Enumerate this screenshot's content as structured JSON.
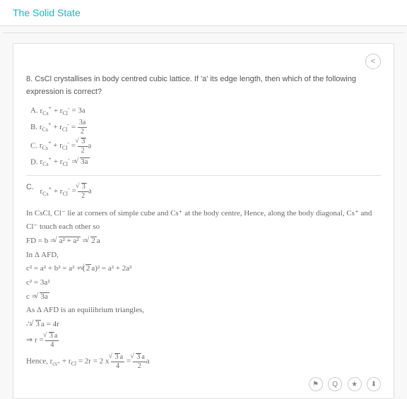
{
  "header": {
    "title": "The Solid State"
  },
  "question": {
    "text": "8.  CsCl crystallises in body centred cubic lattice. If 'a' its edge length, then which of the following expression is correct?"
  },
  "options": {
    "A": {
      "label": "A.",
      "lhs_html": "r<span class='sub'>Cs</span><span class='sup'>+</span> + r<span class='sub'>Cl</span><span class='sup'>-</span>",
      "eq": " = 3a"
    },
    "B": {
      "label": "B.",
      "lhs_html": "r<span class='sub'>Cs</span><span class='sup'>+</span> + r<span class='sub'>Cl</span><span class='sup'>-</span>",
      "frac_num": "3a",
      "frac_den": "2"
    },
    "C": {
      "label": "C.",
      "lhs_html": "r<span class='sub'>Cs</span><span class='sup'>+</span> + r<span class='sub'>Cl</span><span class='sup'>-</span>",
      "frac_num_sqrt": "3",
      "frac_den": "2",
      "tail": "a"
    },
    "D": {
      "label": "D.",
      "lhs_html": "r<span class='sub'>Cs</span><span class='sup'>+</span> + r<span class='sub'>Cl</span><span class='sup'>-</span>",
      "eq_sqrt": "3a"
    }
  },
  "answer": {
    "label": "C."
  },
  "explanation": {
    "line1": "In CsCl, Cl⁻ lie at corners of simple cube and Cs⁺ at the body centre, Hence, along the body diagonal, Cs⁺ and Cl⁻ touch each other so",
    "line2_pre": "FD = b = ",
    "line2_sqrt": "a² + a²",
    "line2_post": " = ",
    "line2_sqrt2": "2",
    "line2_tail": "a",
    "line3": "In Δ AFD,",
    "line4_html": "c² = a² + b² = a² + (<span class='sqrt'>2</span>a)²  = a² + 2a²",
    "line5": "c² = 3a²",
    "line6_pre": "c = ",
    "line6_sqrt": "3a",
    "line7": "As Δ AFD is an equilibrium triangles,",
    "line8_pre": "∴ ",
    "line8_sqrt": "3",
    "line8_post": "a = 4r",
    "line9_pre": "⇒ r = ",
    "line10_pre": "Hence, r",
    "line10_sub1": "cs⁺",
    "line10_mid": " + r",
    "line10_sub2": "Cl",
    "line10_post": " = 2r = 2 x"
  },
  "icons": {
    "share": "<",
    "flag": "⚑",
    "qmark": "Q",
    "star": "★",
    "download": "⬇"
  }
}
